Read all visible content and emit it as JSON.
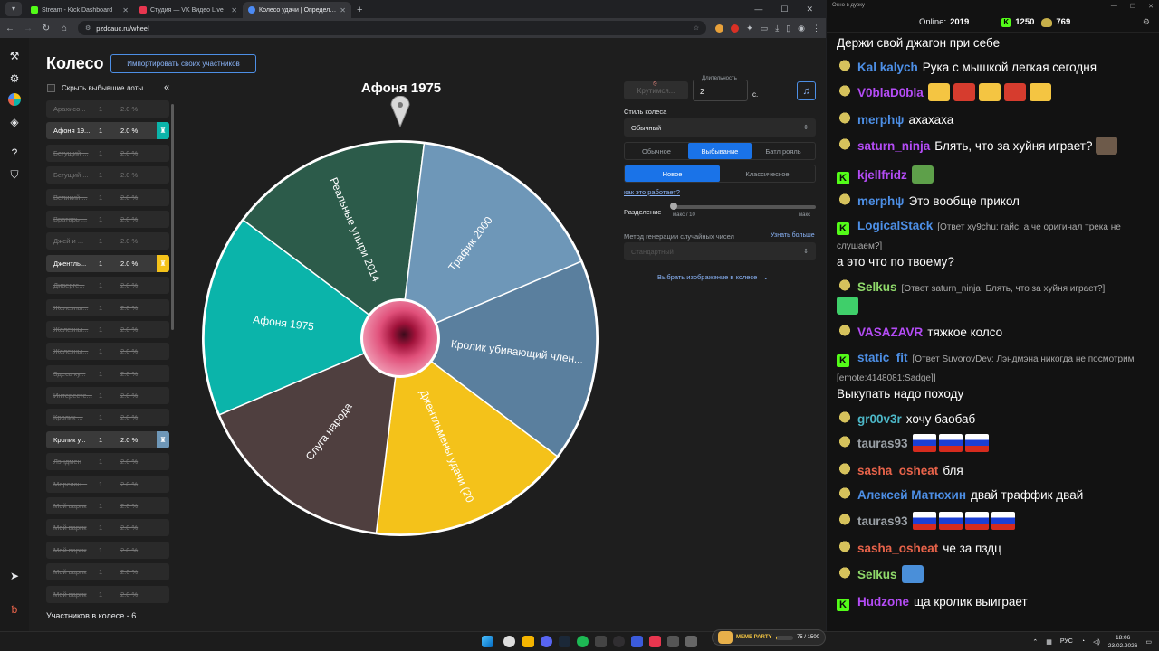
{
  "browser": {
    "tabs": [
      {
        "label": "Stream - Kick Dashboard",
        "color": "#53fc18"
      },
      {
        "label": "Студия — VK Видео Live",
        "color": "#e8364f"
      },
      {
        "label": "Колесо удачи | Определите по",
        "color": "#4c8bf5"
      }
    ],
    "url": "pzdcauc.ru/wheel"
  },
  "wheel_page": {
    "title": "Колесо",
    "import_button": "Импортировать своих участников",
    "hide_won_label": "Скрыть выбывшие лоты",
    "collapse_icon": "«",
    "lots": [
      {
        "name": "Арахисо...",
        "amount": "1",
        "pct": "2.0 %",
        "state": "out"
      },
      {
        "name": "Афоня 19...",
        "amount": "1",
        "pct": "2.0 %",
        "state": "active",
        "color": "#0bb4aa"
      },
      {
        "name": "Бегущий ...",
        "amount": "1",
        "pct": "2.0 %",
        "state": "out"
      },
      {
        "name": "Бегущий ...",
        "amount": "1",
        "pct": "2.0 %",
        "state": "out"
      },
      {
        "name": "Великий ...",
        "amount": "1",
        "pct": "2.0 %",
        "state": "out"
      },
      {
        "name": "Вратарь ...",
        "amount": "1",
        "pct": "2.0 %",
        "state": "out"
      },
      {
        "name": "Джей и ...",
        "amount": "1",
        "pct": "2.0 %",
        "state": "out"
      },
      {
        "name": "Джентль...",
        "amount": "1",
        "pct": "2.0 %",
        "state": "active",
        "color": "#f4c21a"
      },
      {
        "name": "Диверге...",
        "amount": "1",
        "pct": "2.0 %",
        "state": "out"
      },
      {
        "name": "Железны...",
        "amount": "1",
        "pct": "2.0 %",
        "state": "out"
      },
      {
        "name": "Железны...",
        "amount": "1",
        "pct": "2.0 %",
        "state": "out"
      },
      {
        "name": "Железны...",
        "amount": "1",
        "pct": "2.0 %",
        "state": "out"
      },
      {
        "name": "Здесь ку...",
        "amount": "1",
        "pct": "2.0 %",
        "state": "out"
      },
      {
        "name": "Интересте...",
        "amount": "1",
        "pct": "2.0 %",
        "state": "out"
      },
      {
        "name": "Кролик ...",
        "amount": "1",
        "pct": "2.0 %",
        "state": "out"
      },
      {
        "name": "Кролик у...",
        "amount": "1",
        "pct": "2.0 %",
        "state": "active",
        "color": "#6e97b8"
      },
      {
        "name": "Лэндмен",
        "amount": "1",
        "pct": "2.0 %",
        "state": "out"
      },
      {
        "name": "Марсиан...",
        "amount": "1",
        "pct": "2.0 %",
        "state": "out"
      },
      {
        "name": "Мой варик",
        "amount": "1",
        "pct": "2.0 %",
        "state": "out"
      },
      {
        "name": "Мой варик",
        "amount": "1",
        "pct": "2.0 %",
        "state": "out"
      },
      {
        "name": "Мой варик",
        "amount": "1",
        "pct": "2.0 %",
        "state": "out"
      },
      {
        "name": "Мой варик",
        "amount": "1",
        "pct": "2.0 %",
        "state": "out"
      },
      {
        "name": "Мой варик",
        "amount": "1",
        "pct": "2.0 %",
        "state": "out"
      }
    ],
    "participants_count": "Участников в колесе - 6",
    "winner": "Афоня 1975",
    "segments": [
      {
        "label": "Афоня 1975",
        "color": "#0bb4aa"
      },
      {
        "label": "Реальные упыри 2014",
        "color": "#2c5b4a"
      },
      {
        "label": "Трафик 2000",
        "color": "#6e97b8"
      },
      {
        "label": "Кролик убивающий член...",
        "color": "#5a7f9e"
      },
      {
        "label": "Джентльмены удачи (20",
        "color": "#f4c21a"
      },
      {
        "label": "Слуга народа",
        "color": "#4f3f3f"
      }
    ],
    "controls": {
      "spin_button": "Крутимся...",
      "duration_label": "Длительность",
      "duration_value": "2",
      "duration_unit": "с.",
      "style_label": "Стиль колеса",
      "style_value": "Обычный",
      "mode_options": [
        "Обычное",
        "Выбывание",
        "Батл рояль"
      ],
      "mode_selected": "Выбывание",
      "variant_options": [
        "Новое",
        "Классическое"
      ],
      "variant_selected": "Новое",
      "how_link": "как это работает?",
      "split_label": "Разделение",
      "split_min": "макс / 10",
      "split_max": "макс",
      "rng_label": "Метод генерации случайных чисел",
      "rng_link": "Узнать больше",
      "rng_value": "Стандартный",
      "image_select": "Выбрать изображение в колесе"
    }
  },
  "chat": {
    "window_title": "Окно в дурку",
    "online_label": "Online:",
    "online_value": "2019",
    "kick_count": "1250",
    "vk_count": "769",
    "messages": [
      {
        "platform": "none",
        "nick": "",
        "nick_color": "#ffffff",
        "text": "Держи свой джагон при себе",
        "reply": ""
      },
      {
        "platform": "vk",
        "nick": "Kal kalych",
        "nick_color": "#4d8fe6",
        "text": "Рука с мышкой легкая сегодня",
        "reply": ""
      },
      {
        "platform": "vk",
        "nick": "V0blaD0bla",
        "nick_color": "#b44cf5",
        "text": "",
        "reply": "",
        "emotes": [
          "#f4c542",
          "#d63c2e",
          "#f4c542",
          "#d63c2e",
          "#f4c542"
        ]
      },
      {
        "platform": "vk",
        "nick": "merphψ",
        "nick_color": "#4d8fe6",
        "text": "ахахаха",
        "reply": ""
      },
      {
        "platform": "vk",
        "nick": "saturn_ninja",
        "nick_color": "#b44cf5",
        "text": "Блять, что за хуйня играет?",
        "reply": "",
        "emotes": [
          "#6d5a4a"
        ]
      },
      {
        "platform": "kick",
        "nick": "kjellfridz",
        "nick_color": "#b44cf5",
        "text": "",
        "reply": "",
        "emotes": [
          "#5ea04a"
        ]
      },
      {
        "platform": "vk",
        "nick": "merphψ",
        "nick_color": "#4d8fe6",
        "text": "Это вообще прикол",
        "reply": ""
      },
      {
        "platform": "kick",
        "nick": "LogicalStack",
        "nick_color": "#4d8fe6",
        "text": "",
        "reply": "[Ответ xy9chu: гайс, а че оригинал трека не слушаем?]"
      },
      {
        "platform": "none",
        "nick": "",
        "nick_color": "#ffffff",
        "text": "а это что по твоему?",
        "reply": ""
      },
      {
        "platform": "vk",
        "nick": "Selkus",
        "nick_color": "#8fd96a",
        "text": "",
        "reply": "[Ответ saturn_ninja: Блять, что за хуйня играет?]"
      },
      {
        "platform": "none",
        "nick": "",
        "nick_color": "#ffffff",
        "text": "",
        "reply": "",
        "emotes": [
          "#3fcf6a"
        ]
      },
      {
        "platform": "vk",
        "nick": "VASAZAVR",
        "nick_color": "#b44cf5",
        "text": "тяжкое колсо",
        "reply": ""
      },
      {
        "platform": "kick",
        "nick": "static_fit",
        "nick_color": "#4d8fe6",
        "text": "",
        "reply": "[Ответ SuvorovDev: Лэндмэна никогда не посмотрим [emote:4148081:Sadge]]"
      },
      {
        "platform": "none",
        "nick": "",
        "nick_color": "#ffffff",
        "text": "Выкупать надо походу",
        "reply": ""
      },
      {
        "platform": "vk",
        "nick": "gr00v3r",
        "nick_color": "#4db8c8",
        "text": "хочу баобаб",
        "reply": ""
      },
      {
        "platform": "vk",
        "nick": "tauras93",
        "nick_color": "#9aa0a6",
        "text": "",
        "reply": "",
        "flags": 3
      },
      {
        "platform": "vk",
        "nick": "sasha_osheat",
        "nick_color": "#e8634a",
        "text": "бля",
        "reply": ""
      },
      {
        "platform": "vk",
        "nick": "Алексей Матюхин",
        "nick_color": "#4d8fe6",
        "text": "двай траффик двай",
        "reply": ""
      },
      {
        "platform": "vk",
        "nick": "tauras93",
        "nick_color": "#9aa0a6",
        "text": "",
        "reply": "",
        "flags": 4
      },
      {
        "platform": "vk",
        "nick": "sasha_osheat",
        "nick_color": "#e8634a",
        "text": "че за пздц",
        "reply": ""
      },
      {
        "platform": "vk",
        "nick": "Selkus",
        "nick_color": "#8fd96a",
        "text": "",
        "reply": "",
        "emotes": [
          "#4a8fd9"
        ]
      },
      {
        "platform": "kick",
        "nick": "Hudzone",
        "nick_color": "#b44cf5",
        "text": "ща кролик выиграет",
        "reply": ""
      }
    ]
  },
  "taskbar": {
    "meme_name": "MEME PARTY",
    "meme_progress_text": "75 / 1500",
    "meme_progress": 0.05,
    "lang": "РУС",
    "time": "18:06",
    "date": "23.02.2026"
  }
}
